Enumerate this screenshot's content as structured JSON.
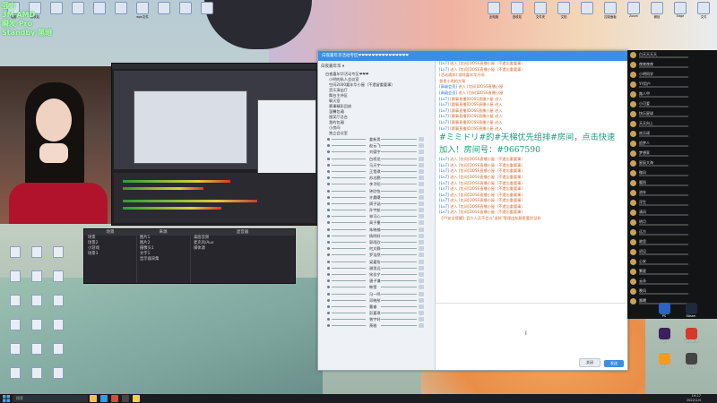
{
  "overlay": {
    "text": "强力\n3M AMD\n瞬发 Pro\nStandby 黑暗"
  },
  "top_icons": [
    {
      "label": "电脑"
    },
    {
      "label": "回收站"
    },
    {
      "label": ""
    },
    {
      "label": ""
    },
    {
      "label": ""
    },
    {
      "label": ""
    },
    {
      "label": "wps文件"
    },
    {
      "label": ""
    },
    {
      "label": ""
    },
    {
      "label": ""
    }
  ],
  "top_right_icons": [
    {
      "label": "此电脑"
    },
    {
      "label": "回收站"
    },
    {
      "label": "文件夹"
    },
    {
      "label": "文档"
    },
    {
      "label": ""
    },
    {
      "label": "控制面板"
    },
    {
      "label": "Zoom"
    },
    {
      "label": "微信"
    },
    {
      "label": "Edge"
    },
    {
      "label": "文件"
    }
  ],
  "chat": {
    "title": "白夜嘉年华活动专区❤❤❤❤❤❤❤❤❤❤❤❤❤❤❤",
    "sidebar_header": "白夜嘉年华 ▾",
    "room_tree": [
      "白夜嘉年华活动专区❤❤❤",
      "小明的私人会议室",
      "空间2000嘉年华小屋（不遗留重要事）",
      "音乐演出厅",
      "舞台主持区",
      "聊天室",
      "赛事精彩回放",
      "温馨包厢",
      "颁奖厅总台",
      "我的包厢",
      "小房间",
      "独立会议室"
    ],
    "user_names": [
      "姜新男",
      "赵云飞",
      "刘德宇",
      "白桥龙",
      "马天宇",
      "王雪琪",
      "苏志鹏",
      "李子阳",
      "钟欣怡",
      "许晨曦",
      "周子涵",
      "孙宇航",
      "林可心",
      "高子墨",
      "朱晓楠",
      "杨明轩",
      "郭雨欣",
      "何文静",
      "罗浩然",
      "梁嘉怡",
      "谢思远",
      "宋佳宁",
      "唐子谦",
      "韩雪",
      "冯一鸣",
      "邓晓彤",
      "曹睿",
      "彭嘉琪",
      "曾宇轩",
      "萧雅"
    ],
    "messages": [
      {
        "who": "[Lv7]",
        "text": "进入 [包间]DOSS直播小屋（不遗忘重要事）"
      },
      {
        "who": "[Lv7]",
        "text": "进入 [包间]DOSS直播小屋（不遗忘重要事）"
      },
      {
        "who": "",
        "text": "[活动通知] 游戏嘉年华开场"
      },
      {
        "who": "",
        "text": "我是小明的大哥"
      },
      {
        "who": "[高级会员]",
        "text": "进入 [包间]DOSS直播小屋"
      },
      {
        "who": "[高级会员]",
        "text": "进入 [包间]DOSS直播小屋"
      },
      {
        "who": "[Lv7]",
        "text": "[赛事直播]DOSS直播小屋 进入"
      },
      {
        "who": "[Lv7]",
        "text": "[赛事直播]DOSS直播小屋 进入"
      },
      {
        "who": "[Lv7]",
        "text": "[赛事直播]DOSS直播小屋 进入"
      },
      {
        "who": "[Lv7]",
        "text": "[赛事直播]DOSS直播小屋 进入"
      },
      {
        "who": "[Lv7]",
        "text": "[赛事直播]DOSS直播小屋 进入"
      },
      {
        "who": "[Lv7]",
        "text": "[赛事直播]DOSS直播小屋 进入"
      }
    ],
    "big_message": "#ミミドリ#的#天梯优先组排#房间，点击快速加入！房间号：#9667590",
    "messages_after": [
      {
        "who": "[Lv7]",
        "text": "进入 [包间]DOSS直播小屋（不遗忘重要事）"
      },
      {
        "who": "[Lv7]",
        "text": "进入 [包间]DOSS直播小屋（不遗忘重要事）"
      },
      {
        "who": "[Lv7]",
        "text": "进入 [包间]DOSS直播小屋（不遗忘重要事）"
      },
      {
        "who": "[Lv7]",
        "text": "进入 [包间]DOSS直播小屋（不遗忘重要事）"
      },
      {
        "who": "[Lv7]",
        "text": "进入 [包间]DOSS直播小屋（不遗忘重要事）"
      },
      {
        "who": "[Lv7]",
        "text": "进入 [包间]DOSS直播小屋（不遗忘重要事）"
      },
      {
        "who": "[Lv7]",
        "text": "进入 [包间]DOSS直播小屋（不遗忘重要事）"
      },
      {
        "who": "[Lv7]",
        "text": "进入 [包间]DOSS直播小屋（不遗忘重要事）"
      },
      {
        "who": "[Lv7]",
        "text": "进入 [包间]DOSS直播小屋（不遗忘重要事）"
      },
      {
        "who": "[Lv7]",
        "text": "进入 [包间]DOSS直播小屋（不遗忘重要事）"
      },
      {
        "who": "",
        "text": "【YY安全提醒】官方人员不会以\"退款\"等理由私聊索要验证码"
      }
    ],
    "send_label": "发送",
    "close_label": "关闭",
    "cursor": "I"
  },
  "mixer": {
    "col_scenes": "场景",
    "col_sources": "来源",
    "col_audio": "混音器",
    "scenes": [
      "场景",
      "场景2",
      "小游戏",
      "场景3"
    ],
    "sources": [
      "图片1",
      "图片2",
      "摄像头1",
      "文字1",
      "显示器采集"
    ],
    "audio": [
      "桌面音频",
      "麦克风/Aux",
      "媒体源"
    ]
  },
  "right_panel": {
    "rows": [
      "白天天天天",
      "夜夜夜夜",
      "小明同学",
      "YY用户",
      "路人甲",
      "小可爱",
      "快乐星球",
      "天天向上",
      "欢乐颂",
      "追梦人",
      "梦想家",
      "星辰大海",
      "微风",
      "暖阳",
      "流年",
      "浮生",
      "清风",
      "明月",
      "远方",
      "故里",
      "初见",
      "心安",
      "繁星",
      "云朵",
      "晚风",
      "晨曦"
    ]
  },
  "right_icons": [
    {
      "label": "PS"
    },
    {
      "label": "Steam"
    },
    {
      "label": "AE"
    },
    {
      "label": "WeGame"
    },
    {
      "label": "AI"
    },
    {
      "label": "游戏"
    }
  ],
  "taskbar": {
    "search_placeholder": "搜索",
    "time": "19:17",
    "date": "2022/1/4"
  },
  "colors": {
    "accent": "#3a8ee6",
    "big_message": "#1b9b7a",
    "taskbar": "#1b1d22"
  }
}
